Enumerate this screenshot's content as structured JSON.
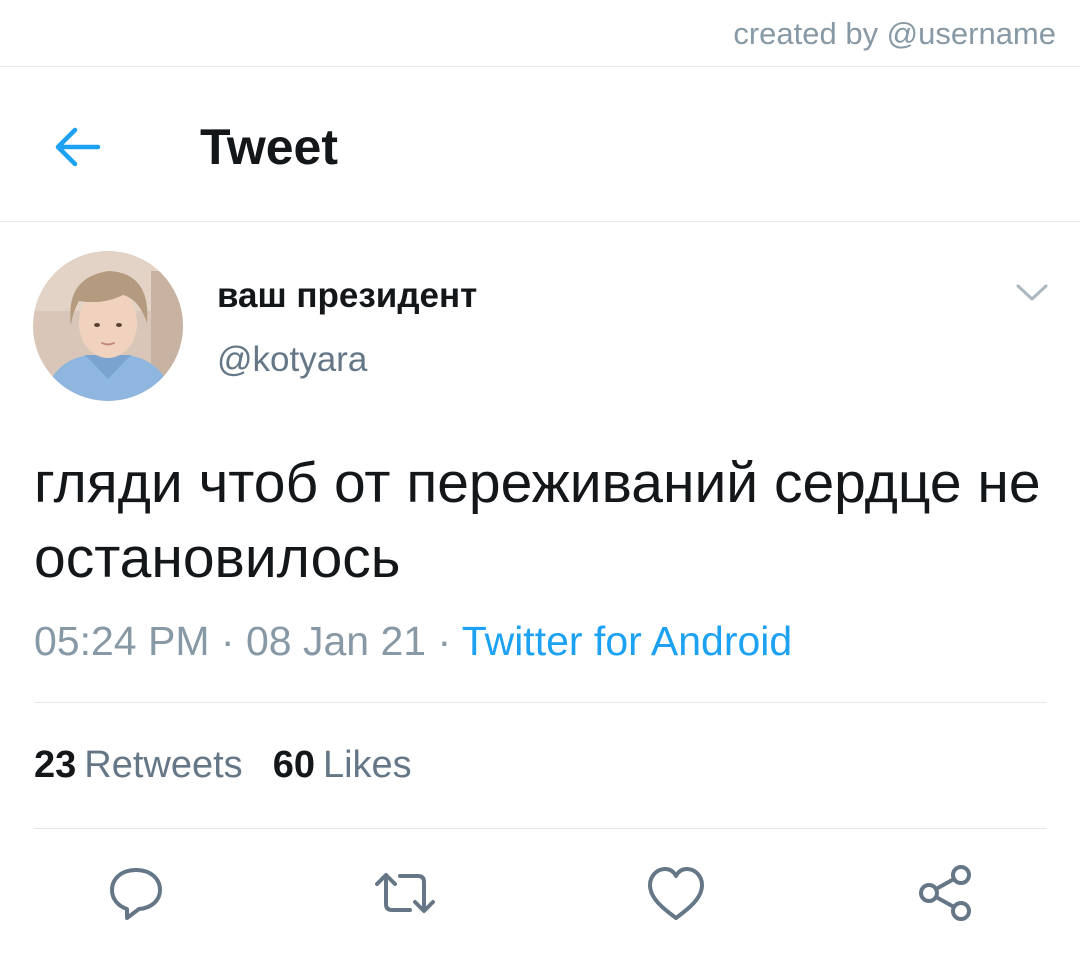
{
  "credit": "created by @username",
  "header": {
    "title": "Tweet",
    "back_icon": "arrow-left-icon"
  },
  "author": {
    "name": "ваш президент",
    "handle": "@kotyara"
  },
  "tweet": {
    "text": "гляди чтоб от переживаний сердце не остановилось",
    "time": "05:24 PM",
    "date": "08 Jan 21",
    "separator": "·",
    "source": "Twitter for Android"
  },
  "stats": {
    "retweets_count": "23",
    "retweets_label": "Retweets",
    "likes_count": "60",
    "likes_label": "Likes"
  },
  "actions": [
    "reply-icon",
    "retweet-icon",
    "like-icon",
    "share-icon"
  ],
  "colors": {
    "accent": "#1da1f2",
    "text": "#14171a",
    "secondary": "#657786",
    "muted": "#8899a6",
    "divider": "#e1e8ed"
  }
}
